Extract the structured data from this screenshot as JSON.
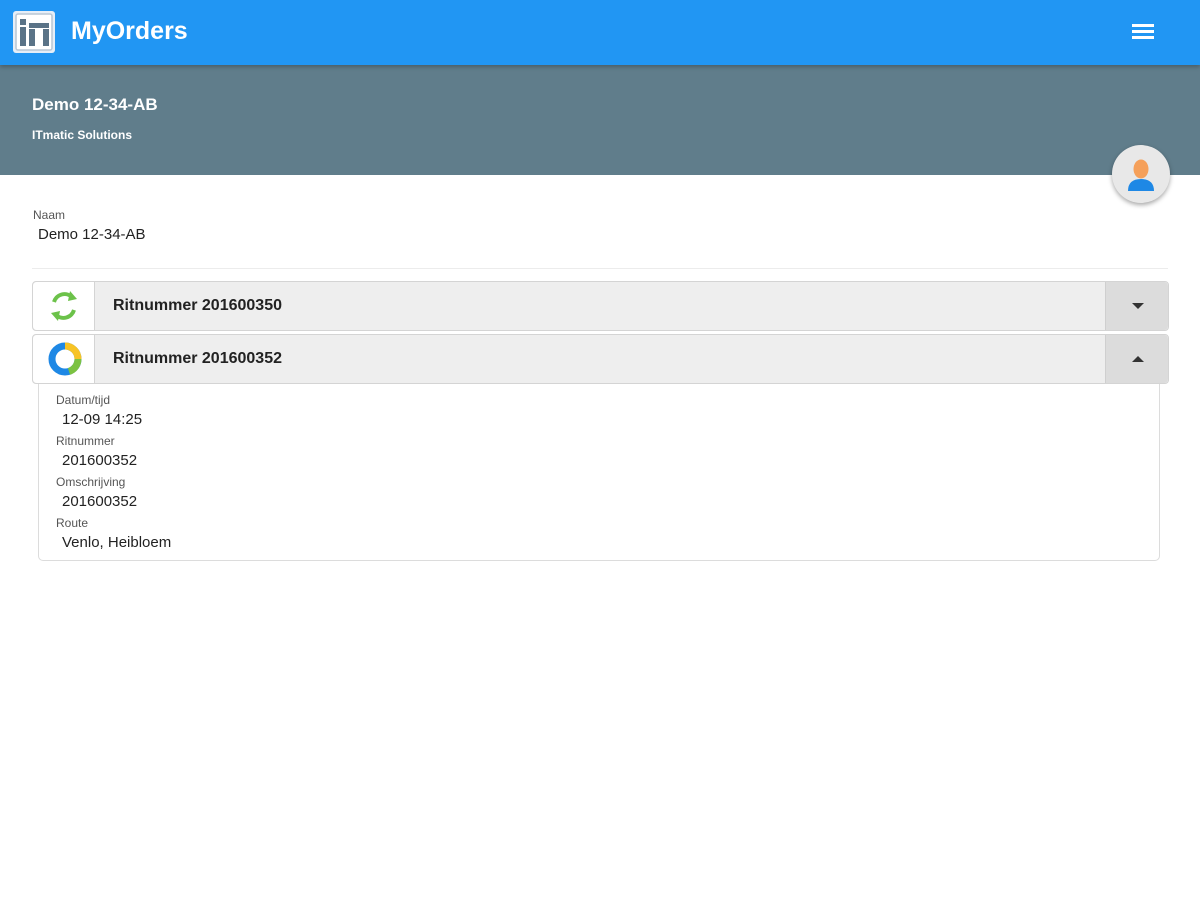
{
  "appbar": {
    "title": "MyOrders",
    "logo_icon": "itmatic-logo-icon",
    "menu_icon": "hamburger-menu-icon",
    "color": "#2196f3"
  },
  "subheader": {
    "title": "Demo 12-34-AB",
    "subtitle": "ITmatic Solutions",
    "color": "#607d8b"
  },
  "avatar": {
    "icon": "user-avatar-icon"
  },
  "profile": {
    "name_label": "Naam",
    "name_value": "Demo 12-34-AB"
  },
  "orders": [
    {
      "title": "Ritnummer 201600350",
      "status_icon": "green-refresh-icon",
      "expanded": false
    },
    {
      "title": "Ritnummer 201600352",
      "status_icon": "progress-ring-icon",
      "expanded": true,
      "fields": [
        {
          "label": "Datum/tijd",
          "value": "12-09 14:25"
        },
        {
          "label": "Ritnummer",
          "value": "201600352"
        },
        {
          "label": "Omschrijving",
          "value": "201600352"
        },
        {
          "label": "Route",
          "value": "Venlo, Heibloem"
        }
      ]
    }
  ]
}
